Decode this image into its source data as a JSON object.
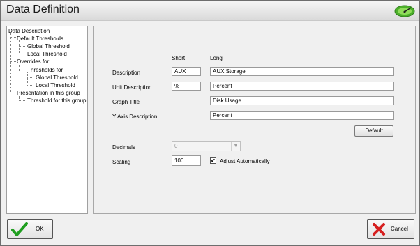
{
  "window": {
    "title": "Data Definition"
  },
  "tree": {
    "items": [
      {
        "label": "Data Description"
      },
      {
        "label": "Default Thresholds"
      },
      {
        "label": "Global Threshold"
      },
      {
        "label": "Local Threshold"
      },
      {
        "label": "Overrides for"
      },
      {
        "label": "Thresholds for"
      },
      {
        "label": "Global Threshold"
      },
      {
        "label": "Local Threshold"
      },
      {
        "label": "Presentation in this group"
      },
      {
        "label": "Threshold for this group"
      }
    ]
  },
  "form": {
    "col_short": "Short",
    "col_long": "Long",
    "description_label": "Description",
    "description_short": "AUX",
    "description_long": "AUX Storage",
    "unit_label": "Unit Description",
    "unit_short": "%",
    "unit_long": "Percent",
    "graph_title_label": "Graph Title",
    "graph_title_value": "Disk Usage",
    "y_axis_label": "Y Axis Description",
    "y_axis_value": "Percent",
    "default_button": "Default",
    "decimals_label": "Decimals",
    "decimals_value": "0",
    "scaling_label": "Scaling",
    "scaling_value": "100",
    "adjust_label": "Adjust Automatically",
    "adjust_checked": true
  },
  "footer": {
    "ok_label": "OK",
    "cancel_label": "Cancel"
  },
  "colors": {
    "ok_check": "#1f9e1f",
    "cancel_x": "#d62020",
    "gauge": "#4caf2a"
  }
}
